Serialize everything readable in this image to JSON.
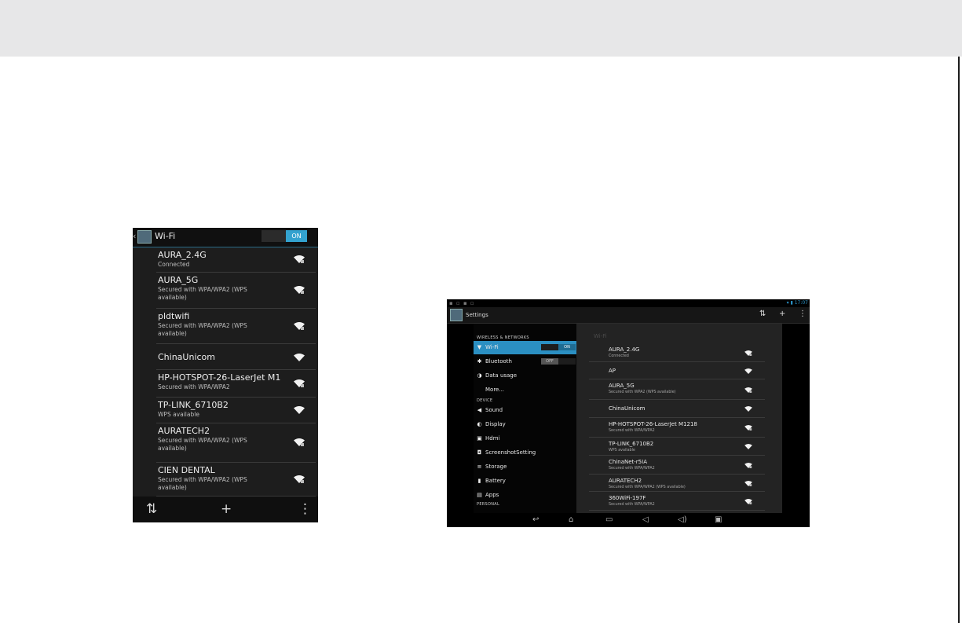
{
  "phone": {
    "title": "Wi-Fi",
    "back_icon": "chevron-left",
    "toggle_label": "ON",
    "networks": [
      {
        "name": "AURA_2.4G",
        "status": "Connected",
        "icon": "wifi-signal-locked"
      },
      {
        "name": "AURA_5G",
        "status": "Secured with WPA/WPA2 (WPS available)",
        "icon": "wifi-signal-locked"
      },
      {
        "name": "pldtwifi",
        "status": "Secured with WPA/WPA2 (WPS available)",
        "icon": "wifi-signal-locked"
      },
      {
        "name": "ChinaUnicom",
        "status": "",
        "icon": "wifi-signal"
      },
      {
        "name": "HP-HOTSPOT-26-LaserJet M1",
        "status": "Secured with WPA/WPA2",
        "icon": "wifi-signal-locked"
      },
      {
        "name": "TP-LINK_6710B2",
        "status": "WPS available",
        "icon": "wifi-signal"
      },
      {
        "name": "AURATECH2",
        "status": "Secured with WPA/WPA2 (WPS available)",
        "icon": "wifi-signal-locked"
      },
      {
        "name": "CIEN DENTAL",
        "status": "Secured with WPA/WPA2 (WPS available)",
        "icon": "wifi-signal-locked"
      }
    ],
    "bottom_actions": {
      "wps": "⇅",
      "add": "+",
      "menu": "⋮"
    }
  },
  "tablet": {
    "status_left": "▪ ▫ ▪ ▫",
    "status_right": "▾ ▮ 17:07",
    "app_title": "Settings",
    "actions": {
      "wps": "⇅",
      "add": "+",
      "menu": "⋮"
    },
    "sections": {
      "wireless": "WIRELESS & NETWORKS",
      "device": "DEVICE",
      "personal": "PERSONAL"
    },
    "nav_wireless": [
      {
        "label": "Wi-Fi",
        "icon": "▼",
        "toggle": "ON"
      },
      {
        "label": "Bluetooth",
        "icon": "✱",
        "toggle": "OFF"
      },
      {
        "label": "Data usage",
        "icon": "◑"
      },
      {
        "label": "More...",
        "icon": ""
      }
    ],
    "nav_device": [
      {
        "label": "Sound",
        "icon": "◀"
      },
      {
        "label": "Display",
        "icon": "◐"
      },
      {
        "label": "Hdmi",
        "icon": "▣"
      },
      {
        "label": "ScreenshotSetting",
        "icon": "◘"
      },
      {
        "label": "Storage",
        "icon": "≡"
      },
      {
        "label": "Battery",
        "icon": "▮"
      },
      {
        "label": "Apps",
        "icon": "▤"
      }
    ],
    "panel_title": "Wi-Fi",
    "networks": [
      {
        "name": "AURA_2.4G",
        "status": "Connected",
        "icon": "wifi-signal-locked"
      },
      {
        "name": "AP",
        "status": "",
        "icon": "wifi-signal"
      },
      {
        "name": "AURA_5G",
        "status": "Secured with WPA2 (WPS available)",
        "icon": "wifi-signal-locked"
      },
      {
        "name": "ChinaUnicom",
        "status": "",
        "icon": "wifi-signal"
      },
      {
        "name": "HP-HOTSPOT-26-LaserJet M1218",
        "status": "Secured with WPA/WPA2",
        "icon": "wifi-signal-locked"
      },
      {
        "name": "TP-LINK_6710B2",
        "status": "WPS available",
        "icon": "wifi-signal"
      },
      {
        "name": "ChinaNet-r5IA",
        "status": "Secured with WPA/WPA2",
        "icon": "wifi-signal-locked"
      },
      {
        "name": "AURATECH2",
        "status": "Secured with WPA/WPA2 (WPS available)",
        "icon": "wifi-signal-locked"
      },
      {
        "name": "360WiFi-197F",
        "status": "Secured with WPA/WPA2",
        "icon": "wifi-signal-locked"
      }
    ],
    "navbar": {
      "back": "↩",
      "home": "⌂",
      "recents": "▭",
      "vol_down": "◁",
      "vol_up": "◁)",
      "screenshot": "▣"
    }
  },
  "colors": {
    "accent": "#33a2cf",
    "selected": "#2b8fc2",
    "page_band": "#e7e7e8"
  }
}
